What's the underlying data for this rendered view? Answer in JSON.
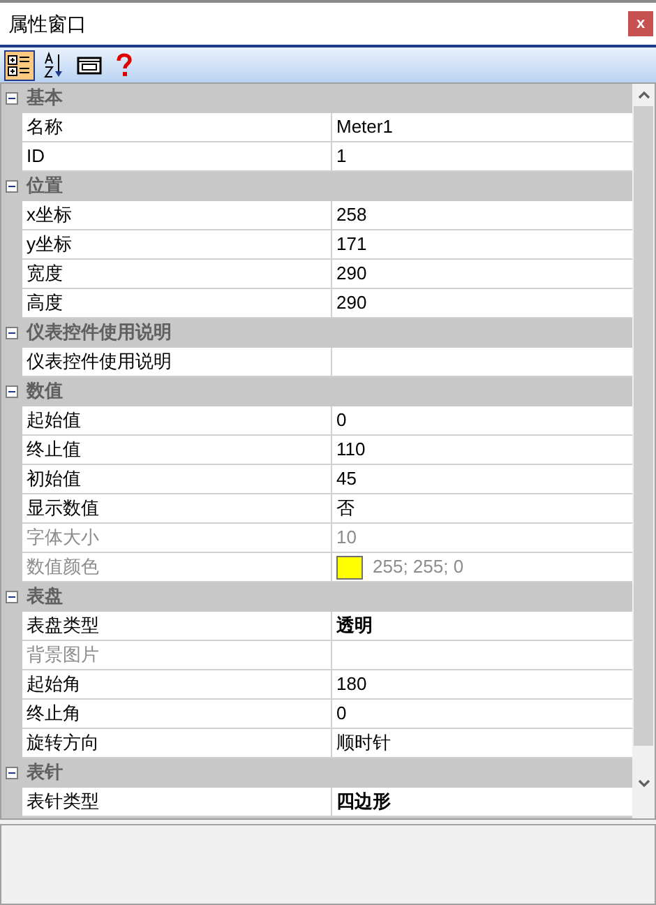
{
  "window": {
    "title": "属性窗口",
    "close": "x"
  },
  "toolbar": [
    {
      "kind": "categorized",
      "selected": true
    },
    {
      "kind": "alphabetical",
      "selected": false
    },
    {
      "kind": "pages",
      "selected": false
    },
    {
      "kind": "help",
      "selected": false
    }
  ],
  "grid": [
    {
      "name": "基本",
      "expanded": true,
      "properties": [
        {
          "name": "名称",
          "value": "Meter1",
          "disabled": false
        },
        {
          "name": "ID",
          "value": "1",
          "disabled": false
        }
      ]
    },
    {
      "name": "位置",
      "expanded": true,
      "properties": [
        {
          "name": "x坐标",
          "value": "258",
          "disabled": false
        },
        {
          "name": "y坐标",
          "value": "171",
          "disabled": false
        },
        {
          "name": "宽度",
          "value": "290",
          "disabled": false
        },
        {
          "name": "高度",
          "value": "290",
          "disabled": false
        }
      ]
    },
    {
      "name": "仪表控件使用说明",
      "expanded": true,
      "properties": [
        {
          "name": "仪表控件使用说明",
          "disabled": false
        }
      ]
    },
    {
      "name": "数值",
      "expanded": true,
      "properties": [
        {
          "name": "起始值",
          "value": "0",
          "disabled": false
        },
        {
          "name": "终止值",
          "value": "110",
          "disabled": false
        },
        {
          "name": "初始值",
          "value": "45",
          "disabled": false
        },
        {
          "name": "显示数值",
          "value": "否",
          "disabled": false
        },
        {
          "name": "字体大小",
          "value": "10",
          "disabled": true
        },
        {
          "name": "数值颜色",
          "value": "255; 255; 0",
          "color": "#ffff00",
          "disabled": true
        }
      ]
    },
    {
      "name": "表盘",
      "expanded": true,
      "properties": [
        {
          "name": "表盘类型",
          "value": "透明",
          "disabled": false,
          "bold": true
        },
        {
          "name": "背景图片",
          "disabled": true
        },
        {
          "name": "起始角",
          "value": "180",
          "disabled": false
        },
        {
          "name": "终止角",
          "value": "0",
          "disabled": false
        },
        {
          "name": "旋转方向",
          "value": "顺时针",
          "disabled": false
        }
      ]
    },
    {
      "name": "表针",
      "expanded": true,
      "properties": [
        {
          "name": "表针类型",
          "value": "四边形",
          "disabled": false,
          "bold": true
        }
      ]
    }
  ]
}
